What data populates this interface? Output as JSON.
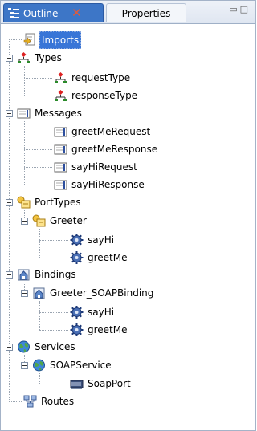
{
  "tabs": {
    "outline": "Outline",
    "properties": "Properties"
  },
  "tree": {
    "imports": "Imports",
    "types": "Types",
    "types_children": [
      "requestType",
      "responseType"
    ],
    "messages": "Messages",
    "messages_children": [
      "greetMeRequest",
      "greetMeResponse",
      "sayHiRequest",
      "sayHiResponse"
    ],
    "port_types": "PortTypes",
    "greeter": "Greeter",
    "greeter_ops": [
      "sayHi",
      "greetMe"
    ],
    "bindings": "Bindings",
    "greeter_binding": "Greeter_SOAPBinding",
    "binding_ops": [
      "sayHi",
      "greetMe"
    ],
    "services": "Services",
    "soap_service": "SOAPService",
    "soap_port": "SoapPort",
    "routes": "Routes"
  }
}
